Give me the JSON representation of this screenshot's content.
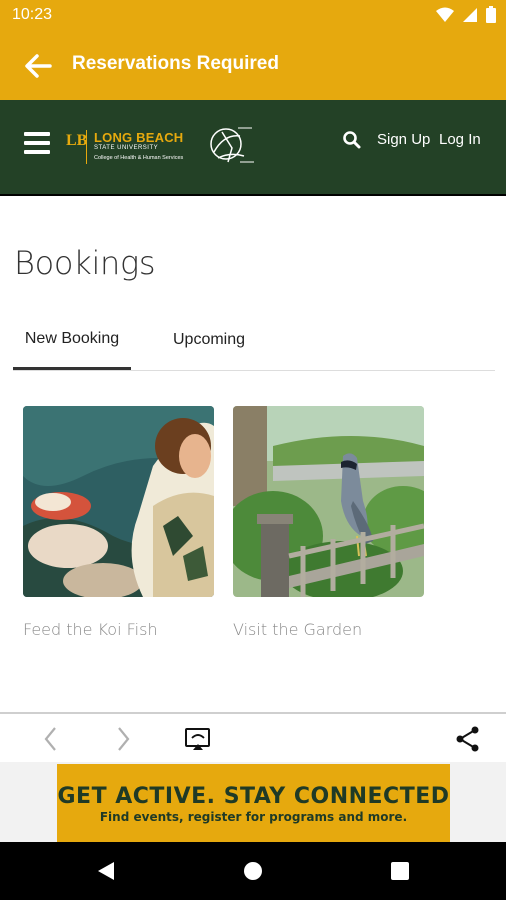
{
  "status_bar": {
    "time": "10:23",
    "icons": [
      "wifi-icon",
      "cell-signal-icon",
      "battery-icon"
    ]
  },
  "app_bar": {
    "title": "Reservations Required",
    "back_icon": "arrow-back-icon",
    "color": "#e6a90e"
  },
  "site_header": {
    "menu_icon": "hamburger-menu-icon",
    "logo": {
      "mark": "LB",
      "title": "LONG BEACH",
      "subtitle": "STATE UNIVERSITY",
      "college": "College of Health & Human Services"
    },
    "search_icon": "search-icon",
    "sign_up": "Sign Up",
    "log_in": "Log In",
    "color": "#234126"
  },
  "page": {
    "title": "Bookings"
  },
  "tabs": [
    {
      "label": "New Booking",
      "active": true
    },
    {
      "label": "Upcoming",
      "active": false
    }
  ],
  "cards": [
    {
      "label": "Feed the Koi Fish",
      "image": "koi-fish-photo"
    },
    {
      "label": "Visit the Garden",
      "image": "garden-heron-photo"
    }
  ],
  "browser_toolbar": {
    "icons": [
      "back-arrow-icon",
      "forward-arrow-icon",
      "cast-icon",
      "share-icon"
    ]
  },
  "banner": {
    "headline": "GET ACTIVE.  STAY CONNECTED",
    "subtext": "Find events, register for programs and more."
  },
  "nav_bar": {
    "icons": [
      "back-triangle-icon",
      "home-circle-icon",
      "recents-square-icon"
    ]
  }
}
